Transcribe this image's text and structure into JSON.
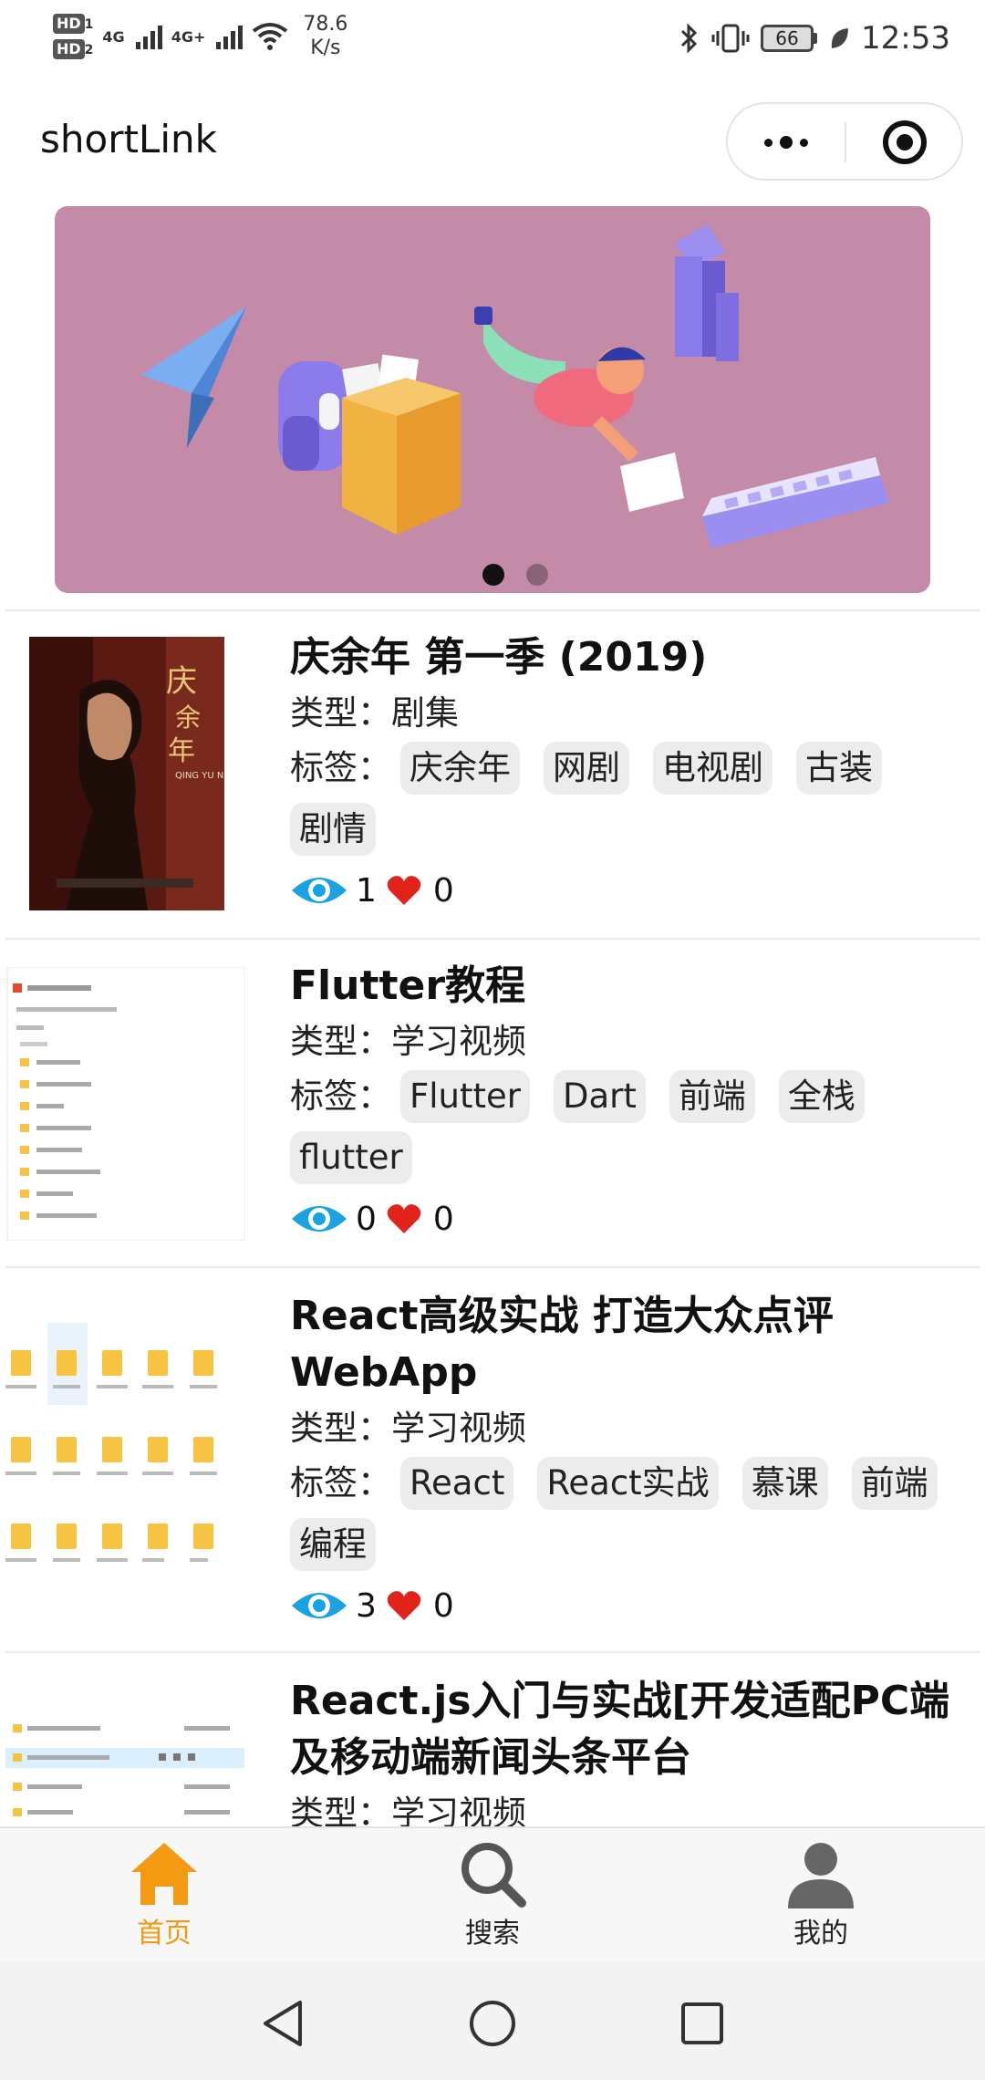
{
  "status_bar": {
    "hd1": "HD",
    "hd1_sub": "1",
    "hd2": "HD",
    "hd2_sub": "2",
    "net1": "4G",
    "net2": "4G+",
    "speed_value": "78.6",
    "speed_unit": "K/s",
    "battery": "66",
    "time": "12:53"
  },
  "header": {
    "title": "shortLink"
  },
  "banner": {
    "slides": 2,
    "active_slide": 0,
    "background": "#c38ba7"
  },
  "items": [
    {
      "title": "庆余年 第一季 (2019)",
      "type_label": "类型：",
      "type": "剧集",
      "tags_label": "标签：",
      "tags": [
        "庆余年",
        "网剧",
        "电视剧",
        "古装",
        "剧情"
      ],
      "views": "1",
      "likes": "0",
      "poster_text": "QING YU NIAN"
    },
    {
      "title": "Flutter教程",
      "type_label": "类型：",
      "type": "学习视频",
      "tags_label": "标签：",
      "tags": [
        "Flutter",
        "Dart",
        "前端",
        "全栈",
        "flutter"
      ],
      "views": "0",
      "likes": "0"
    },
    {
      "title": "React高级实战 打造大众点评 WebApp",
      "type_label": "类型：",
      "type": "学习视频",
      "tags_label": "标签：",
      "tags": [
        "React",
        "React实战",
        "慕课",
        "前端",
        "编程"
      ],
      "views": "3",
      "likes": "0"
    },
    {
      "title": "React.js入门与实战[开发适配PC端及移动端新闻头条平台",
      "type_label": "类型：",
      "type": "学习视频"
    }
  ],
  "tab_bar": {
    "home": "首页",
    "search": "搜索",
    "mine": "我的",
    "active_color": "#f39a12"
  },
  "colors": {
    "eye": "#1aa3e0",
    "heart": "#e0241b"
  }
}
